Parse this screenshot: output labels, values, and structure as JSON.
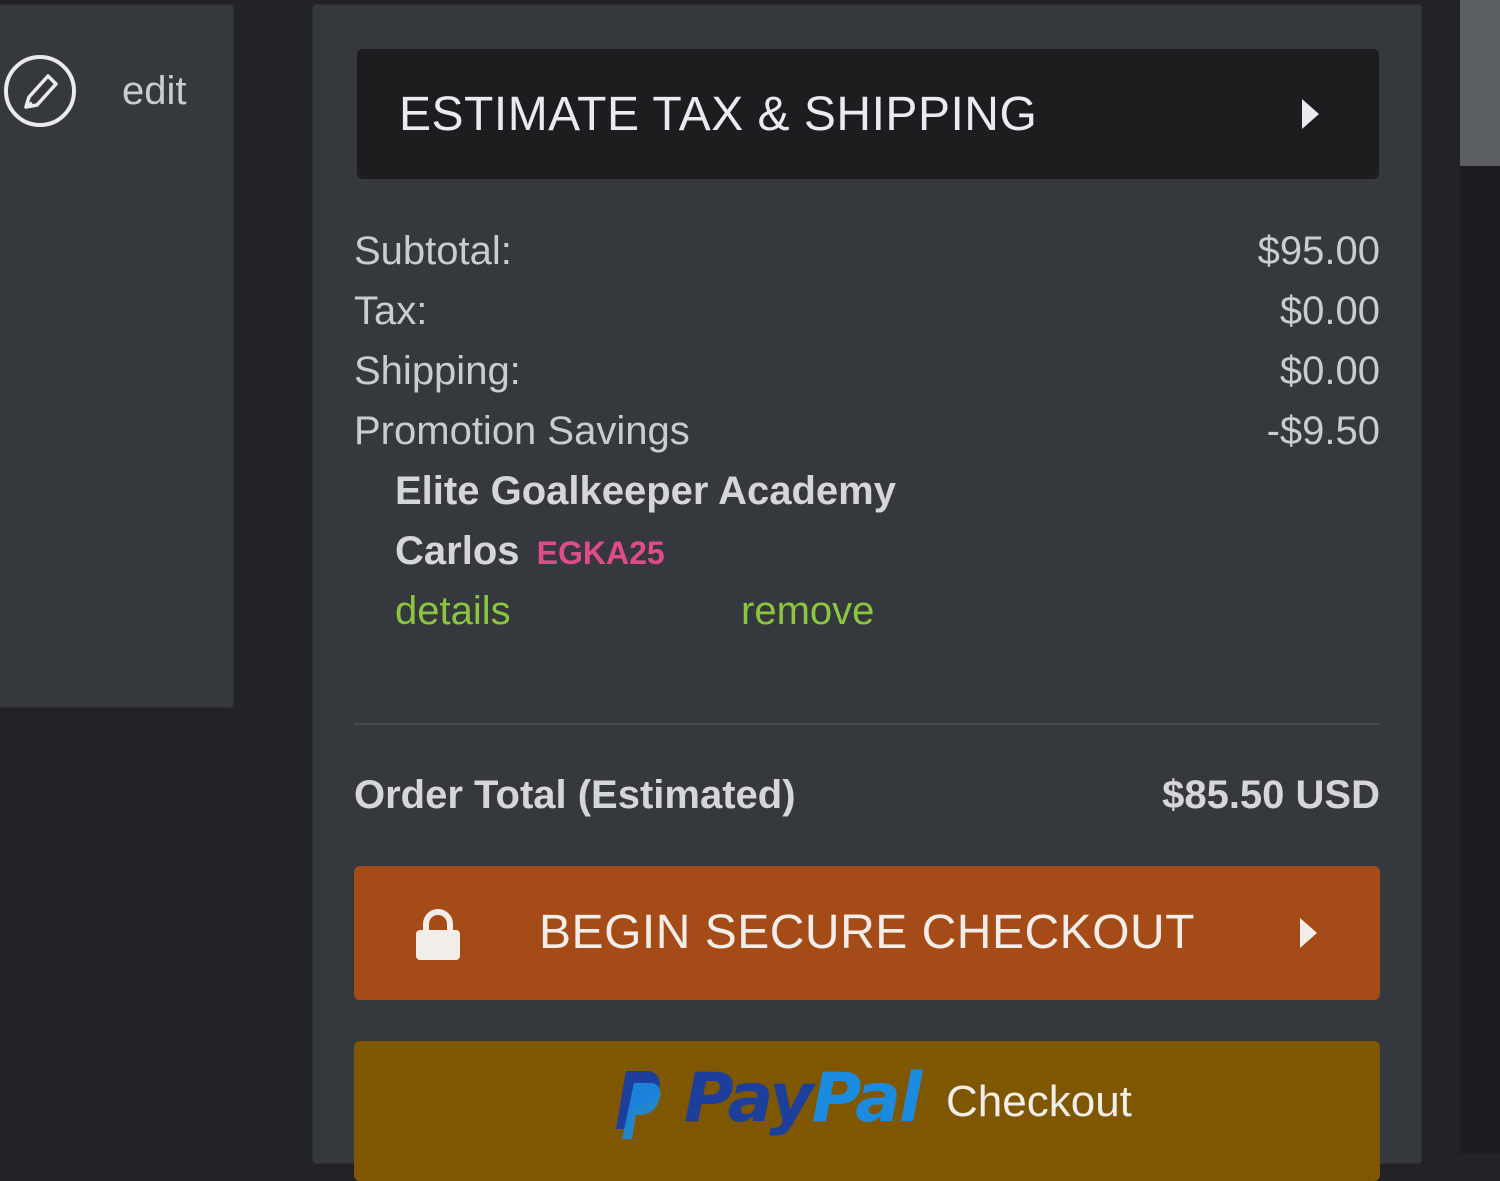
{
  "left_panel": {
    "edit_label": "edit"
  },
  "summary": {
    "estimate_label": "ESTIMATE TAX & SHIPPING",
    "lines": [
      {
        "label": "Subtotal:",
        "value": "$95.00"
      },
      {
        "label": "Tax:",
        "value": "$0.00"
      },
      {
        "label": "Shipping:",
        "value": "$0.00"
      },
      {
        "label": "Promotion Savings",
        "value": "-$9.50"
      }
    ],
    "promotion": {
      "name_line1": "Elite Goalkeeper Academy",
      "name_line2": "Carlos",
      "code": "EGKA25",
      "details_link": "details",
      "remove_link": "remove"
    },
    "total_label": "Order Total (Estimated)",
    "total_value": "$85.50 USD"
  },
  "buttons": {
    "checkout_label": "BEGIN SECURE CHECKOUT",
    "paypal_pay": "Pay",
    "paypal_pal": "Pal",
    "paypal_checkout": "Checkout"
  },
  "colors": {
    "accent_orange": "#a54b17",
    "paypal_gold": "#7f5700",
    "link_green": "#8cc640",
    "promo_code_pink": "#e04b8a",
    "panel_bg": "#35383c",
    "page_bg": "#222326"
  },
  "icons": {
    "edit": "pencil-circle-icon",
    "estimate_caret": "caret-right-icon",
    "lock": "lock-icon",
    "paypal": "paypal-logo-icon"
  }
}
